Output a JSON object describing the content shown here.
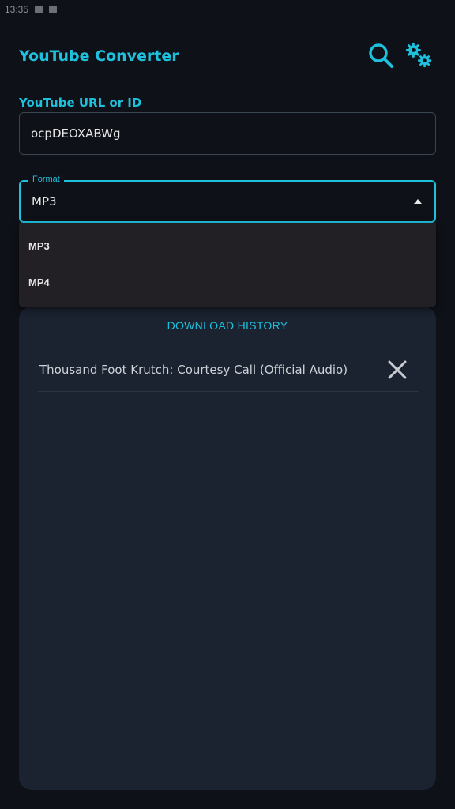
{
  "status_bar": {
    "time": "13:35"
  },
  "app": {
    "title": "YouTube Converter"
  },
  "toolbar": {
    "search_icon": "search-icon",
    "settings_icon": "gears-icon"
  },
  "url_field": {
    "label": "YouTube URL or ID",
    "value": "ocpDEOXABWg"
  },
  "format_field": {
    "legend": "Format",
    "selected": "MP3",
    "options": [
      "MP3",
      "MP4"
    ]
  },
  "history": {
    "title": "DOWNLOAD HISTORY",
    "items": [
      {
        "title": "Thousand Foot Krutch: Courtesy Call (Official Audio)"
      }
    ]
  },
  "colors": {
    "background": "#0e1117",
    "accent": "#1ec0dc",
    "panel": "#1b2230",
    "menu": "#221f25"
  }
}
